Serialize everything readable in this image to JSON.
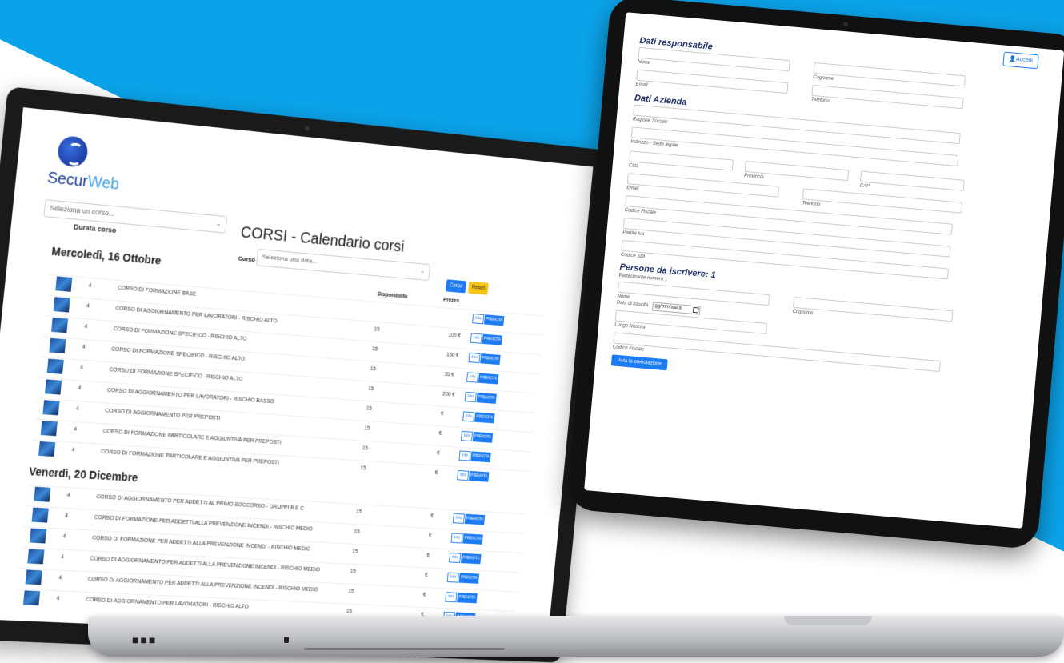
{
  "colors": {
    "background_accent": "#0aa3ea",
    "primary": "#1c7cf4",
    "warning": "#f5c518",
    "brand": "#1b3d99"
  },
  "laptop": {
    "logo": {
      "part1": "Secur",
      "part2": "Web"
    },
    "select_course_placeholder": "Seleziona un corso...",
    "durata_label": "Durata corso",
    "page_title": "CORSI - Calendario corsi",
    "select_date_placeholder": "Seleziona una data...",
    "corso_label": "Corso",
    "cerca_label": "Cerca",
    "reset_label": "Reset",
    "col_disponibilita": "Disponibilità",
    "col_prezzo": "Prezzo",
    "info_label": "Info",
    "prenota_label": "PRENOTA",
    "groups": [
      {
        "date": "Mercoledì, 16 Ottobre",
        "rows": [
          {
            "dur": "4",
            "title": "CORSO DI FORMAZIONE BASE",
            "disp": "",
            "price": ""
          },
          {
            "dur": "4",
            "title": "CORSO DI AGGIORNAMENTO PER LAVORATORI - RISCHIO ALTO",
            "disp": "15",
            "price": "100 €"
          },
          {
            "dur": "4",
            "title": "CORSO DI FORMAZIONE SPECIFICO - RISCHIO ALTO",
            "disp": "15",
            "price": "150 €"
          },
          {
            "dur": "4",
            "title": "CORSO DI FORMAZIONE SPECIFICO - RISCHIO ALTO",
            "disp": "15",
            "price": "35 €"
          },
          {
            "dur": "4",
            "title": "CORSO DI FORMAZIONE SPECIFICO - RISCHIO ALTO",
            "disp": "15",
            "price": "200 €"
          },
          {
            "dur": "4",
            "title": "CORSO DI AGGIORNAMENTO PER LAVORATORI - RISCHIO BASSO",
            "disp": "15",
            "price": "€"
          },
          {
            "dur": "4",
            "title": "CORSO DI AGGIORNAMENTO PER PREPOSTI",
            "disp": "15",
            "price": "€"
          },
          {
            "dur": "4",
            "title": "CORSO DI FORMAZIONE PARTICOLARE E AGGIUNTIVA PER PREPOSTI",
            "disp": "15",
            "price": "€"
          },
          {
            "dur": "4",
            "title": "CORSO DI FORMAZIONE PARTICOLARE E AGGIUNTIVA PER PREPOSTI",
            "disp": "15",
            "price": "€"
          }
        ]
      },
      {
        "date": "Venerdì, 20 Dicembre",
        "rows": [
          {
            "dur": "4",
            "title": "CORSO DI AGGIORNAMENTO PER ADDETTI AL PRIMO SOCCORSO - GRUPPI B E C",
            "disp": "15",
            "price": "€"
          },
          {
            "dur": "4",
            "title": "CORSO DI FORMAZIONE PER ADDETTI ALLA PREVENZIONE INCENDI - RISCHIO MEDIO",
            "disp": "15",
            "price": "€"
          },
          {
            "dur": "4",
            "title": "CORSO DI FORMAZIONE PER ADDETTI ALLA PREVENZIONE INCENDI - RISCHIO MEDIO",
            "disp": "15",
            "price": "€"
          },
          {
            "dur": "4",
            "title": "CORSO DI AGGIORNAMENTO PER ADDETTI ALLA PREVENZIONE INCENDI - RISCHIO MEDIO",
            "disp": "15",
            "price": "€"
          },
          {
            "dur": "4",
            "title": "CORSO DI AGGIORNAMENTO PER ADDETTI ALLA PREVENZIONE INCENDI - RISCHIO MEDIO",
            "disp": "15",
            "price": "€"
          },
          {
            "dur": "4",
            "title": "CORSO DI AGGIORNAMENTO PER LAVORATORI - RISCHIO ALTO",
            "disp": "15",
            "price": "€"
          }
        ]
      }
    ]
  },
  "tablet": {
    "accedi_label": "Accedi",
    "section_responsabile": "Dati responsabile",
    "section_azienda": "Dati Azienda",
    "section_persone": "Persone da iscrivere: 1",
    "partecipante": "Partecipante numero 1",
    "labels": {
      "nome": "Nome",
      "cognome": "Cognome",
      "email": "Email",
      "telefono": "Telefono",
      "ragione_sociale": "Ragione Sociale",
      "indirizzo": "Indirizzo - Sede legale",
      "citta": "Città",
      "provincia": "Provincia",
      "cap": "CAP",
      "email_az": "Email",
      "telefono_az": "Telefono",
      "codice_fiscale": "Codice Fiscale",
      "partita_iva": "Partita Iva",
      "codice_sdi": "Codice SDI",
      "nome_p": "Nome",
      "cognome_p": "Cognome",
      "data_nascita": "Data di nascita",
      "luogo_nascita": "Luogo Nascita",
      "codice_fiscale_p": "Codice Fiscale"
    },
    "date_placeholder": "gg/mm/aaaa",
    "invia_label": "Invia la prenotazione"
  },
  "brand_on_base": "■■■"
}
